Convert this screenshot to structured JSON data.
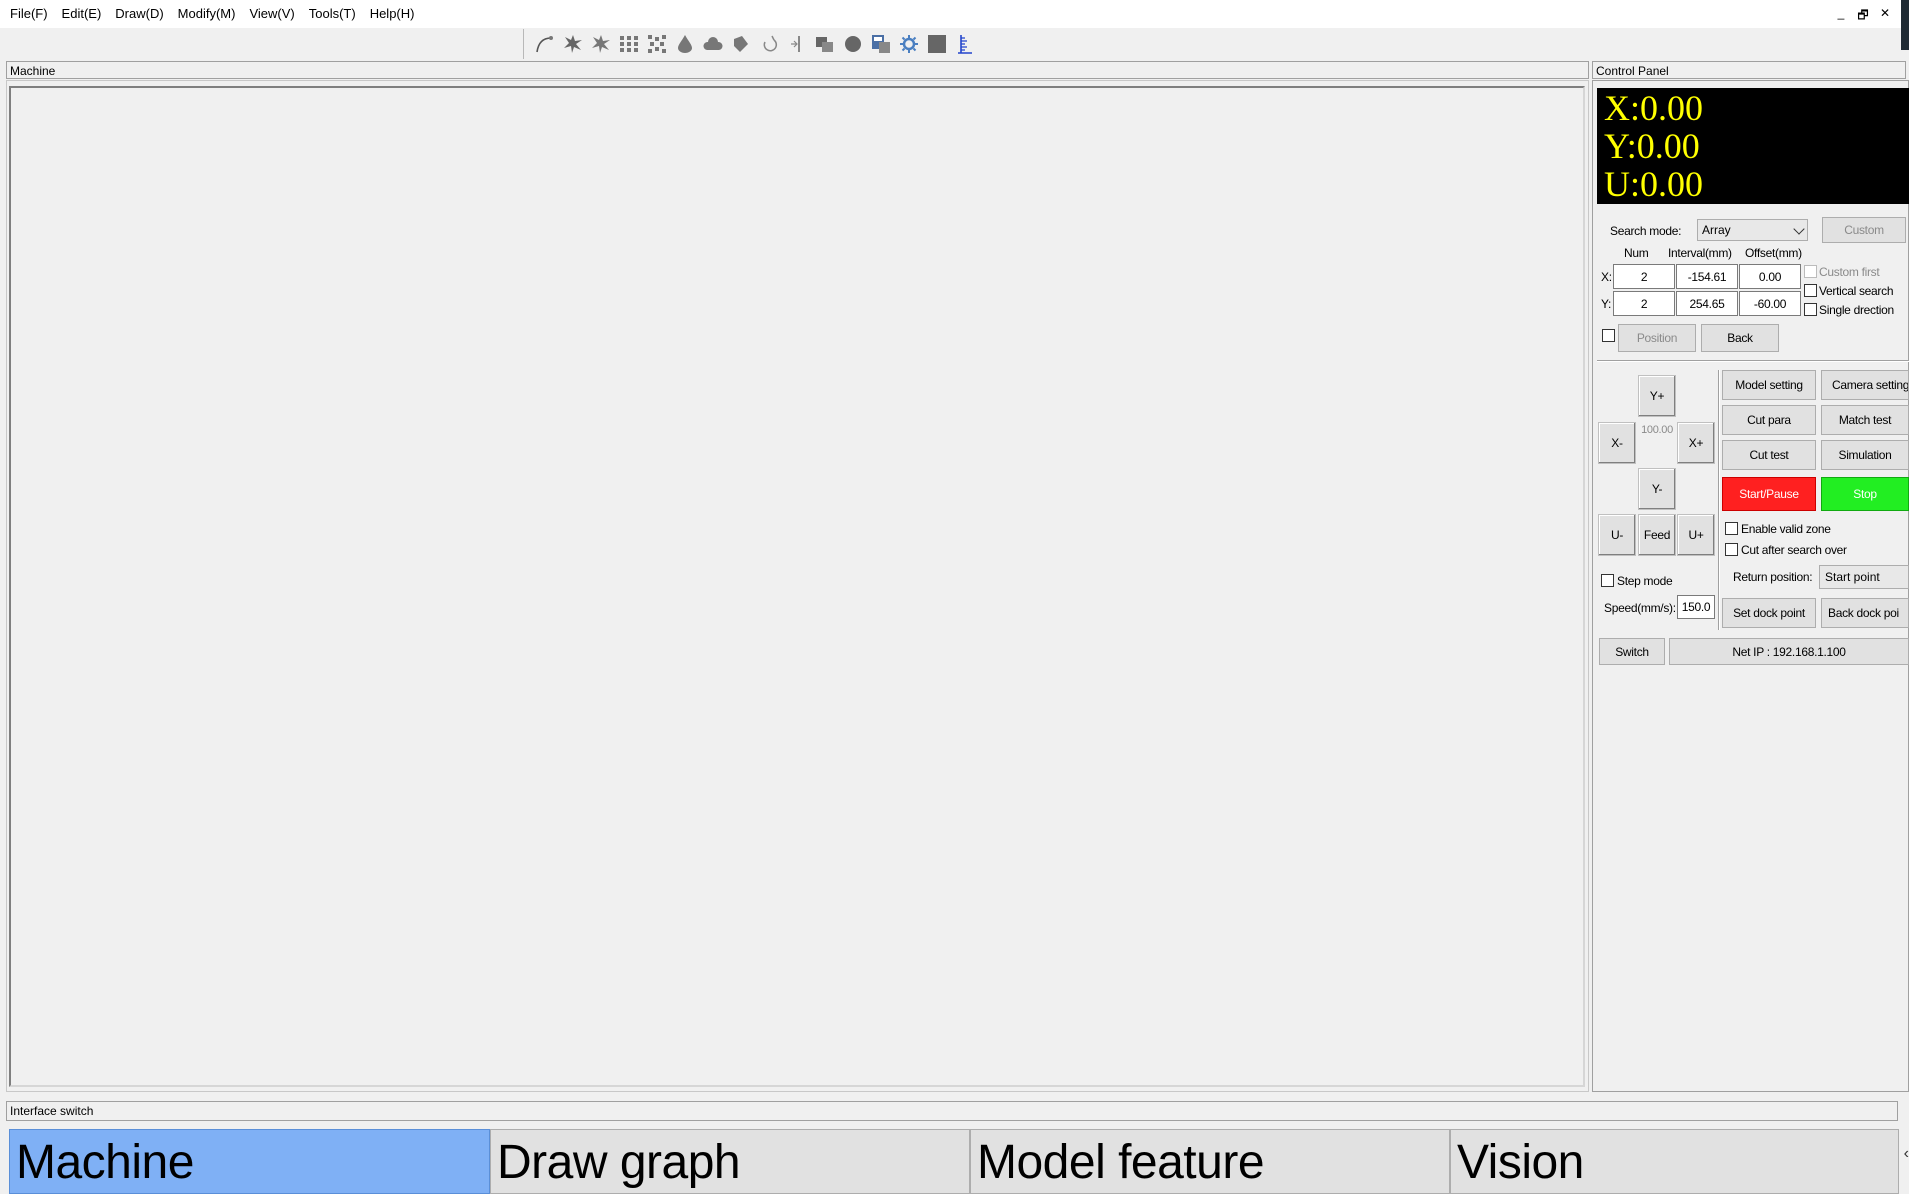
{
  "menubar": {
    "items": [
      "File(F)",
      "Edit(E)",
      "Draw(D)",
      "Modify(M)",
      "View(V)",
      "Tools(T)",
      "Help(H)"
    ]
  },
  "window_controls": {
    "minimize": "_",
    "restore": "🗗",
    "close": "✕"
  },
  "toolbar": {
    "icons": [
      "curve-tool-icon",
      "burst-icon",
      "burst-alt-icon",
      "grid-array-icon",
      "grid-diagonal-icon",
      "drop-icon",
      "cloud-icon",
      "bucket-icon",
      "hook-icon",
      "mirror-icon",
      "layers-icon",
      "circle-fill-icon",
      "camera-screen-icon",
      "gear-icon",
      "square-fill-icon",
      "ruler-icon"
    ]
  },
  "machine_panel": {
    "title": "Machine"
  },
  "control_panel": {
    "title": "Control Panel",
    "coords": {
      "x": "X:0.00",
      "y": "Y:0.00",
      "u": "U:0.00"
    },
    "search_mode_label": "Search mode:",
    "search_mode_value": "Array",
    "custom_button": "Custom",
    "headers": {
      "num": "Num",
      "interval": "Interval(mm)",
      "offset": "Offset(mm)"
    },
    "row_x": {
      "label": "X:",
      "num": "2",
      "interval": "-154.61",
      "offset": "0.00"
    },
    "row_y": {
      "label": "Y:",
      "num": "2",
      "interval": "254.65",
      "offset": "-60.00"
    },
    "options": {
      "custom_first": "Custom first",
      "vertical_search": "Vertical search",
      "single_direction": "Single drection"
    },
    "position_button": "Position",
    "back_button": "Back",
    "jog": {
      "y_plus": "Y+",
      "y_minus": "Y-",
      "x_minus": "X-",
      "x_plus": "X+",
      "step_value": "100.00",
      "u_minus": "U-",
      "feed": "Feed",
      "u_plus": "U+"
    },
    "step_mode_label": "Step mode",
    "speed_label": "Speed(mm/s):",
    "speed_value": "150.0",
    "actions": {
      "model_setting": "Model setting",
      "camera_setting": "Camera setting",
      "cut_para": "Cut para",
      "match_test": "Match test",
      "cut_test": "Cut test",
      "simulation": "Simulation",
      "start_pause": "Start/Pause",
      "stop": "Stop"
    },
    "enable_valid_zone": "Enable valid zone",
    "cut_after_search": "Cut after search over",
    "return_position_label": "Return position:",
    "return_position_value": "Start point",
    "set_dock_point": "Set dock point",
    "back_dock_point": "Back dock poi",
    "switch_button": "Switch",
    "net_ip": "Net IP : 192.168.1.100"
  },
  "interface_switch": {
    "title": "Interface switch",
    "tabs": [
      "Machine",
      "Draw graph",
      "Model feature",
      "Vision"
    ],
    "active": "Machine"
  },
  "colors": {
    "coord_bg": "#000000",
    "coord_text": "#ffff00",
    "start_pause": "#ff2020",
    "stop": "#22ee22",
    "active_tab": "#7fb0f5"
  }
}
